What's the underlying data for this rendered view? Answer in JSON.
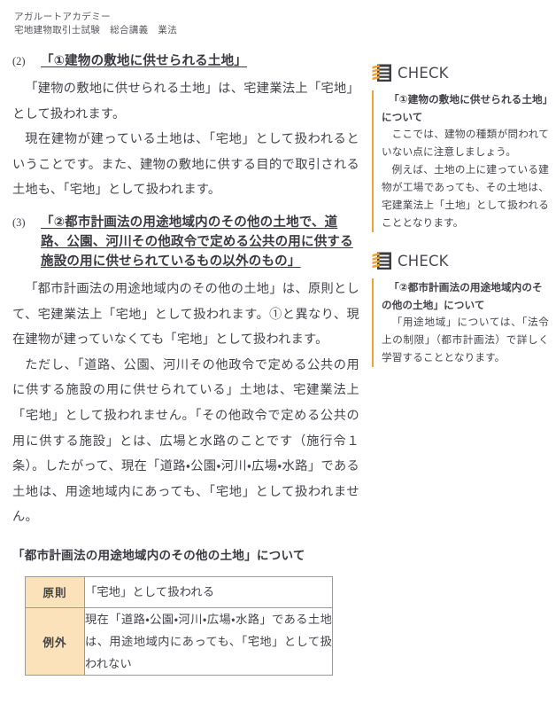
{
  "header": {
    "academy": "アガルートアカデミー",
    "course_exam": "宅地建物取引士試験",
    "course_type": "総合講義",
    "course_subject": "業法"
  },
  "main": {
    "sections": [
      {
        "number": "(2)",
        "title": "「①建物の敷地に供せられる土地」",
        "paragraphs": [
          "「建物の敷地に供せられる土地」は、宅建業法上「宅地」として扱われます。",
          "現在建物が建っている土地は、「宅地」として扱われるということです。また、建物の敷地に供する目的で取引される土地も、「宅地」として扱われます。"
        ]
      },
      {
        "number": "(3)",
        "title": "「②都市計画法の用途地域内のその他の土地で、道路、公園、河川その他政令で定める公共の用に供する施設の用に供せられているもの以外のもの」",
        "paragraphs": [
          "「都市計画法の用途地域内のその他の土地」は、原則として、宅建業法上「宅地」として扱われます。①と異なり、現在建物が建っていなくても「宅地」として扱われます。",
          "ただし、「道路、公園、河川その他政令で定める公共の用に供する施設の用に供せられている」土地は、宅建業法上「宅地」として扱われません。「その他政令で定める公共の用に供する施設」とは、広場と水路のことです（施行令１条）。したがって、現在「道路・公園・河川・広場・水路」である土地は、用途地域内にあっても、「宅地」として扱われません。"
        ]
      }
    ],
    "table": {
      "caption": "「都市計画法の用途地域内のその他の土地」について",
      "rows": [
        {
          "label": "原則",
          "value": "「宅地」として扱われる"
        },
        {
          "label": "例外",
          "value": "現在「道路・公園・河川・広場・水路」である土地は、用途地域内にあっても、「宅地」として扱われない"
        }
      ]
    }
  },
  "sidebar": {
    "blocks": [
      {
        "icon": "check-stack-icon",
        "heading": "CHECK",
        "title": "「①建物の敷地に供せられる土地」について",
        "paragraphs": [
          "ここでは、建物の種類が問われていない点に注意しましょう。",
          "例えば、土地の上に建っている建物が工場であっても、その土地は、宅建業法上「土地」として扱われることとなります。"
        ]
      },
      {
        "icon": "check-stack-icon",
        "heading": "CHECK",
        "title": "「②都市計画法の用途地域内のその他の土地」について",
        "paragraphs": [
          "「用途地域」については、「法令上の制限」（都市計画法）で詳しく学習することとなります。"
        ]
      }
    ]
  },
  "colors": {
    "accent_orange": "#f0a13a",
    "table_header_bg": "#fbe2bb",
    "table_border": "#9a9a9a",
    "text": "#44444b"
  }
}
